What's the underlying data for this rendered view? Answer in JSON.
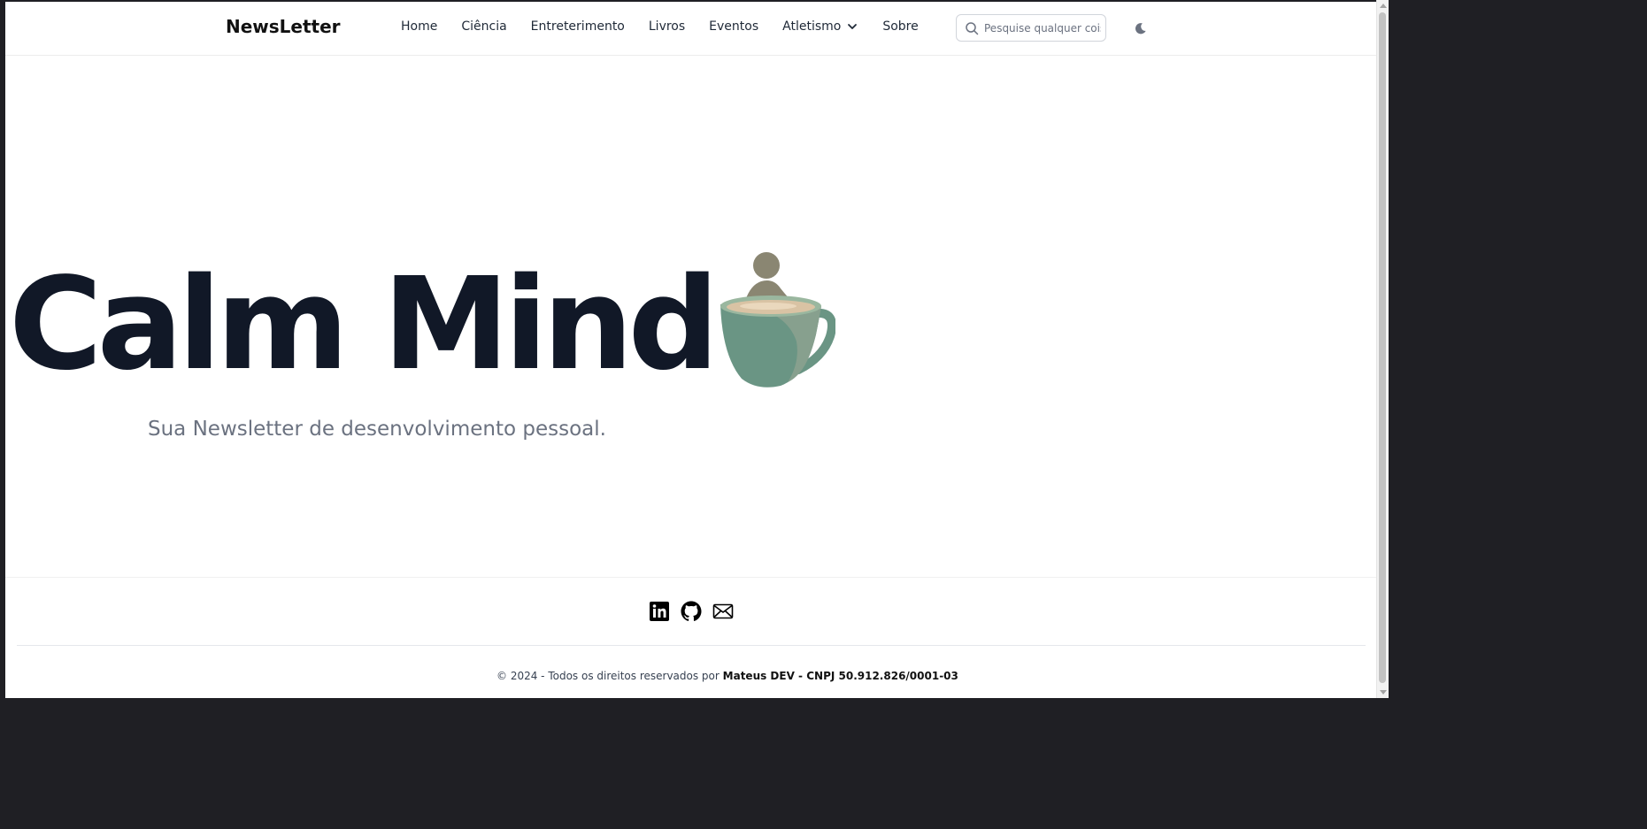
{
  "header": {
    "brand": "NewsLetter",
    "nav": [
      {
        "label": "Home"
      },
      {
        "label": "Ciência"
      },
      {
        "label": "Entreterimento"
      },
      {
        "label": "Livros"
      },
      {
        "label": "Eventos"
      },
      {
        "label": "Atletismo",
        "has_dropdown": true,
        "icon": "chevron-down-icon"
      },
      {
        "label": "Sobre"
      }
    ],
    "search": {
      "placeholder": "Pesquise qualquer coisa...",
      "value": "",
      "icon": "search-icon"
    },
    "theme_toggle": {
      "icon": "moon-icon"
    }
  },
  "hero": {
    "title": "Calm Mind",
    "subtitle": "Sua Newsletter de desenvolvimento pessoal.",
    "image": "coffee-cup-illustration"
  },
  "footer": {
    "socials": [
      {
        "icon": "linkedin-icon"
      },
      {
        "icon": "github-icon"
      },
      {
        "icon": "email-icon"
      }
    ],
    "copyright_prefix": "© 2024 - Todos os direitos reservados por",
    "copyright_owner": "Mateus DEV - CNPJ 50.912.826/0001-03"
  },
  "colors": {
    "title": "#111827",
    "subtitle": "#6b7280",
    "cup_body": "#6a9584",
    "cup_figure": "#8a8672"
  }
}
